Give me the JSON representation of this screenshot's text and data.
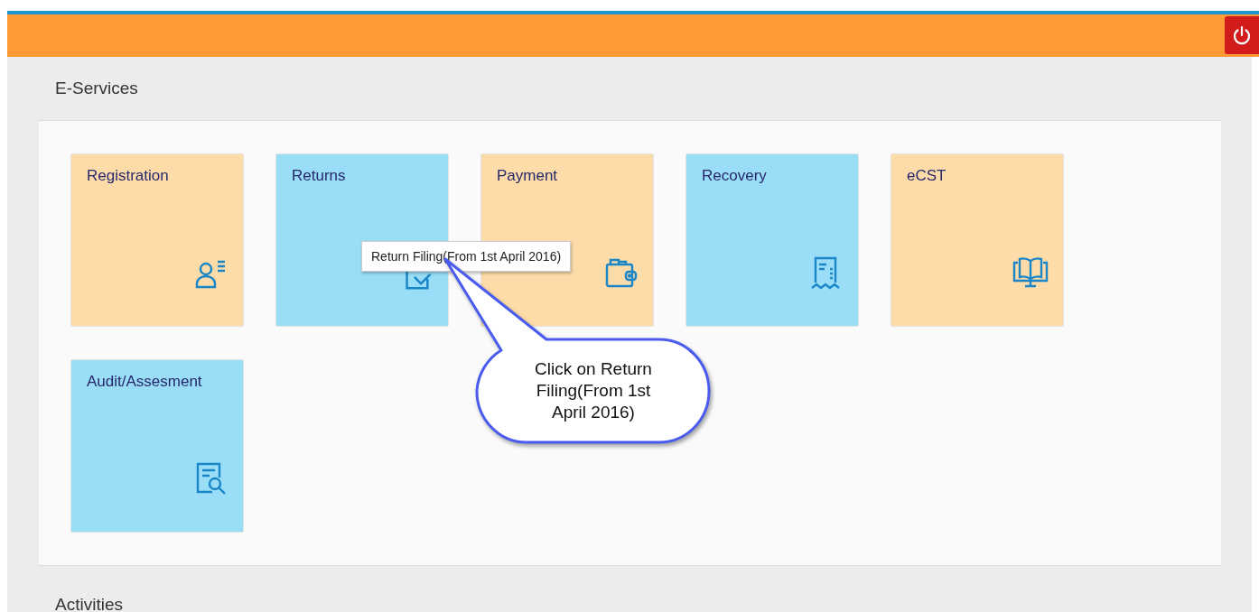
{
  "section": {
    "title": "E-Services"
  },
  "tiles": [
    {
      "name": "Registration",
      "color": "#fddcaa"
    },
    {
      "name": "Returns",
      "color": "#99def6"
    },
    {
      "name": "Payment",
      "color": "#fddcaa"
    },
    {
      "name": "Recovery",
      "color": "#99def6"
    },
    {
      "name": "eCST",
      "color": "#fddcaa"
    },
    {
      "name": "Audit/Assesment",
      "color": "#99def6"
    }
  ],
  "tooltip": {
    "text": "Return Filing(From 1st April 2016)"
  },
  "callout": {
    "text": "Click on Return Filing(From 1st April 2016)"
  },
  "next_section": {
    "title": "Activities"
  }
}
